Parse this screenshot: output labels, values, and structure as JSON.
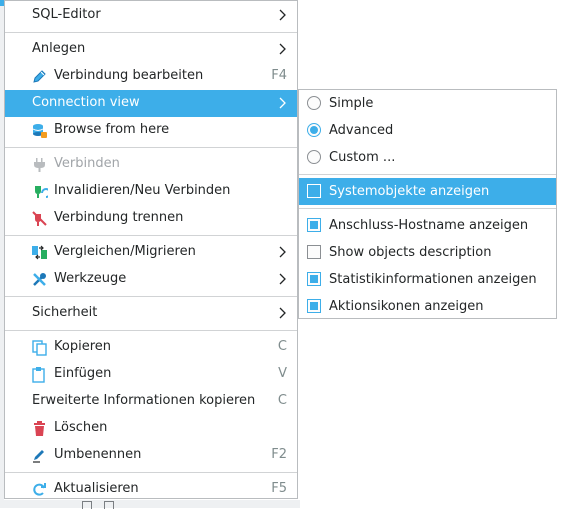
{
  "context_menu": {
    "items": [
      {
        "label": "SQL-Editor",
        "has_submenu": true
      },
      {
        "label": "Anlegen",
        "has_submenu": true
      },
      {
        "label": "Verbindung bearbeiten",
        "icon": "pencil-icon",
        "shortcut": "F4"
      },
      {
        "label": "Connection view",
        "has_submenu": true,
        "selected": true
      },
      {
        "label": "Browse from here",
        "icon": "database-icon"
      },
      {
        "label": "Verbinden",
        "icon": "plug-icon",
        "disabled": true
      },
      {
        "label": "Invalidieren/Neu Verbinden",
        "icon": "reconnect-icon"
      },
      {
        "label": "Verbindung trennen",
        "icon": "disconnect-icon"
      },
      {
        "label": "Vergleichen/Migrieren",
        "icon": "compare-icon",
        "has_submenu": true
      },
      {
        "label": "Werkzeuge",
        "icon": "tools-icon",
        "has_submenu": true
      },
      {
        "label": "Sicherheit",
        "has_submenu": true
      },
      {
        "label": "Kopieren",
        "icon": "copy-icon",
        "shortcut": "C"
      },
      {
        "label": "Einfügen",
        "icon": "paste-icon",
        "shortcut": "V"
      },
      {
        "label": "Erweiterte Informationen kopieren",
        "shortcut": "C"
      },
      {
        "label": "Löschen",
        "icon": "trash-icon"
      },
      {
        "label": "Umbenennen",
        "icon": "rename-icon",
        "shortcut": "F2"
      },
      {
        "label": "Aktualisieren",
        "icon": "refresh-icon",
        "shortcut": "F5"
      }
    ]
  },
  "connection_view_submenu": {
    "items": [
      {
        "label": "Simple",
        "type": "radio",
        "checked": false
      },
      {
        "label": "Advanced",
        "type": "radio",
        "checked": true
      },
      {
        "label": "Custom ...",
        "type": "radio",
        "checked": false
      },
      {
        "label": "Systemobjekte anzeigen",
        "type": "checkbox",
        "checked": false,
        "selected": true
      },
      {
        "label": "Anschluss-Hostname anzeigen",
        "type": "checkbox",
        "checked": true
      },
      {
        "label": "Show objects description",
        "type": "checkbox",
        "checked": false
      },
      {
        "label": "Statistikinformationen anzeigen",
        "type": "checkbox",
        "checked": true
      },
      {
        "label": "Aktionsikonen anzeigen",
        "type": "checkbox",
        "checked": true
      }
    ]
  },
  "colors": {
    "accent": "#3daee9",
    "menu_background": "#ffffff",
    "text": "#232627",
    "disabled_text": "#a0a4a8",
    "shortcut_text": "#7f8c8d"
  }
}
